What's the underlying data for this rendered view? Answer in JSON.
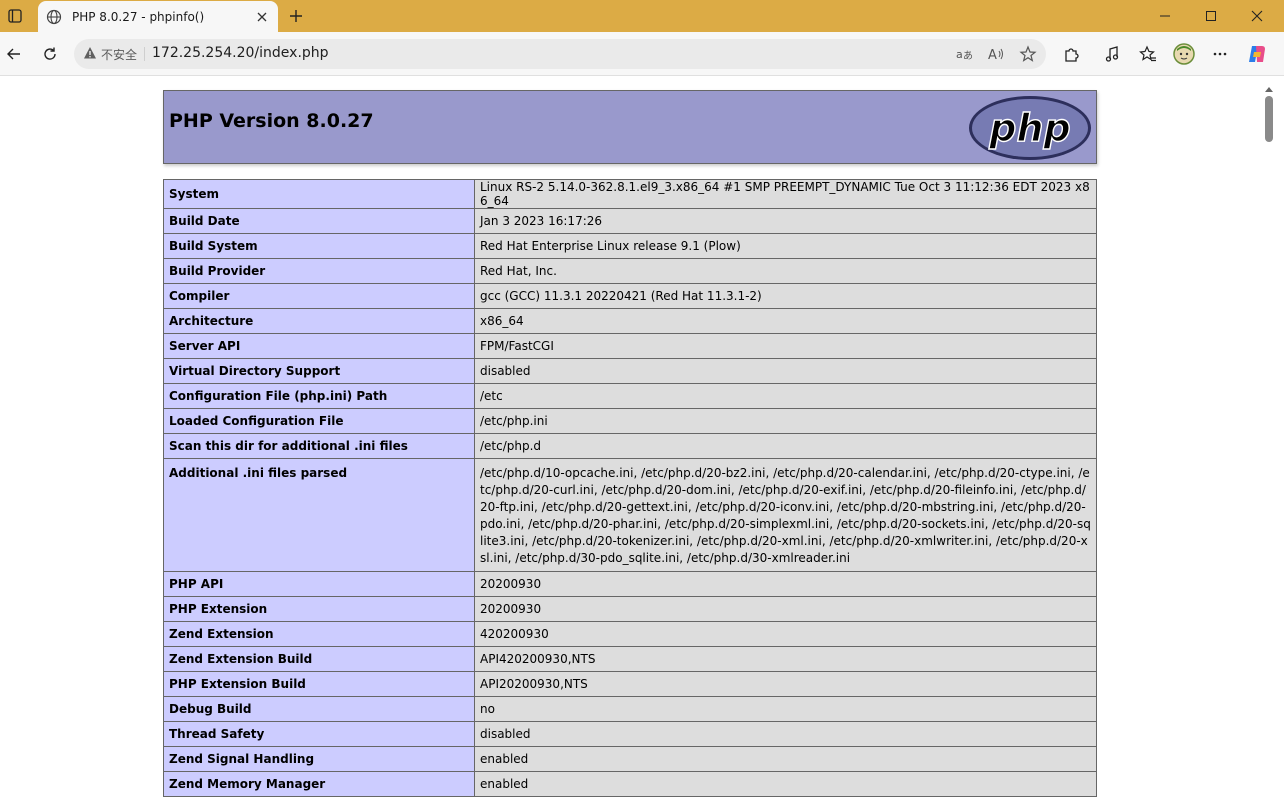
{
  "browser": {
    "tab_title": "PHP 8.0.27 - phpinfo()",
    "security_label": "不安全",
    "url": "172.25.254.20/index.php",
    "colors": {
      "titlebar": "#dcab45",
      "toolbar": "#f7f7f7"
    }
  },
  "page": {
    "heading": "PHP Version 8.0.27",
    "logo_text": "php",
    "rows": [
      {
        "key": "System",
        "value": "Linux RS-2 5.14.0-362.8.1.el9_3.x86_64 #1 SMP PREEMPT_DYNAMIC Tue Oct 3 11:12:36 EDT 2023 x86_64"
      },
      {
        "key": "Build Date",
        "value": "Jan 3 2023 16:17:26"
      },
      {
        "key": "Build System",
        "value": "Red Hat Enterprise Linux release 9.1 (Plow)"
      },
      {
        "key": "Build Provider",
        "value": "Red Hat, Inc."
      },
      {
        "key": "Compiler",
        "value": "gcc (GCC) 11.3.1 20220421 (Red Hat 11.3.1-2)"
      },
      {
        "key": "Architecture",
        "value": "x86_64"
      },
      {
        "key": "Server API",
        "value": "FPM/FastCGI"
      },
      {
        "key": "Virtual Directory Support",
        "value": "disabled"
      },
      {
        "key": "Configuration File (php.ini) Path",
        "value": "/etc"
      },
      {
        "key": "Loaded Configuration File",
        "value": "/etc/php.ini"
      },
      {
        "key": "Scan this dir for additional .ini files",
        "value": "/etc/php.d"
      },
      {
        "key": "Additional .ini files parsed",
        "value": "/etc/php.d/10-opcache.ini, /etc/php.d/20-bz2.ini, /etc/php.d/20-calendar.ini, /etc/php.d/20-ctype.ini, /etc/php.d/20-curl.ini, /etc/php.d/20-dom.ini, /etc/php.d/20-exif.ini, /etc/php.d/20-fileinfo.ini, /etc/php.d/20-ftp.ini, /etc/php.d/20-gettext.ini, /etc/php.d/20-iconv.ini, /etc/php.d/20-mbstring.ini, /etc/php.d/20-pdo.ini, /etc/php.d/20-phar.ini, /etc/php.d/20-simplexml.ini, /etc/php.d/20-sockets.ini, /etc/php.d/20-sqlite3.ini, /etc/php.d/20-tokenizer.ini, /etc/php.d/20-xml.ini, /etc/php.d/20-xmlwriter.ini, /etc/php.d/20-xsl.ini, /etc/php.d/30-pdo_sqlite.ini, /etc/php.d/30-xmlreader.ini"
      },
      {
        "key": "PHP API",
        "value": "20200930"
      },
      {
        "key": "PHP Extension",
        "value": "20200930"
      },
      {
        "key": "Zend Extension",
        "value": "420200930"
      },
      {
        "key": "Zend Extension Build",
        "value": "API420200930,NTS"
      },
      {
        "key": "PHP Extension Build",
        "value": "API20200930,NTS"
      },
      {
        "key": "Debug Build",
        "value": "no"
      },
      {
        "key": "Thread Safety",
        "value": "disabled"
      },
      {
        "key": "Zend Signal Handling",
        "value": "enabled"
      },
      {
        "key": "Zend Memory Manager",
        "value": "enabled"
      }
    ],
    "colors": {
      "header_bg": "#9999cc",
      "key_bg": "#ccccff",
      "value_bg": "#dddddd"
    }
  },
  "icons": {
    "tab_actions": "tab-actions-icon",
    "favicon": "globe-icon",
    "close_tab": "close-icon",
    "new_tab": "plus-icon",
    "minimize": "minimize-icon",
    "maximize": "maximize-icon",
    "close_window": "close-icon",
    "back": "back-arrow-icon",
    "refresh": "refresh-icon",
    "warning": "warning-icon",
    "translate": "translate-icon",
    "read_aloud": "read-aloud-icon",
    "favorite": "star-icon",
    "extensions": "puzzle-icon",
    "media": "music-icon",
    "favorites": "favorites-icon",
    "profile": "avatar-icon",
    "more": "more-icon",
    "copilot": "copilot-icon"
  }
}
